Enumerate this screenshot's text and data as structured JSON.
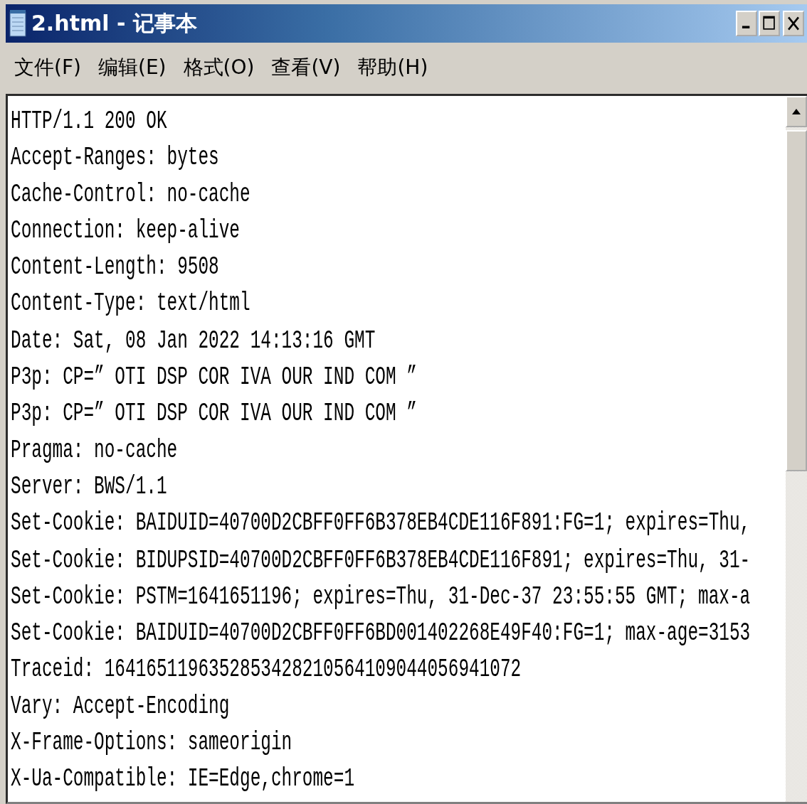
{
  "window": {
    "title": "2.html - 记事本"
  },
  "menu": [
    "文件(F)",
    "编辑(E)",
    "格式(O)",
    "查看(V)",
    "帮助(H)"
  ],
  "editor": {
    "lines": [
      "HTTP/1.1 200 OK",
      "Accept-Ranges: bytes",
      "Cache-Control: no-cache",
      "Connection: keep-alive",
      "Content-Length: 9508",
      "Content-Type: text/html",
      "Date: Sat, 08 Jan 2022 14:13:16 GMT",
      "P3p: CP=” OTI DSP COR IVA OUR IND COM ”",
      "P3p: CP=” OTI DSP COR IVA OUR IND COM ”",
      "Pragma: no-cache",
      "Server: BWS/1.1",
      "Set-Cookie: BAIDUID=40700D2CBFF0FF6B378EB4CDE116F891:FG=1; expires=Thu,",
      "Set-Cookie: BIDUPSID=40700D2CBFF0FF6B378EB4CDE116F891; expires=Thu, 31-",
      "Set-Cookie: PSTM=1641651196; expires=Thu, 31-Dec-37 23:55:55 GMT; max-a",
      "Set-Cookie: BAIDUID=40700D2CBFF0FF6BD001402268E49F40:FG=1; max-age=3153",
      "Traceid: 1641651196352853428210564109044056941072",
      "Vary: Accept-Encoding",
      "X-Frame-Options: sameorigin",
      "X-Ua-Compatible: IE=Edge,chrome=1"
    ]
  }
}
